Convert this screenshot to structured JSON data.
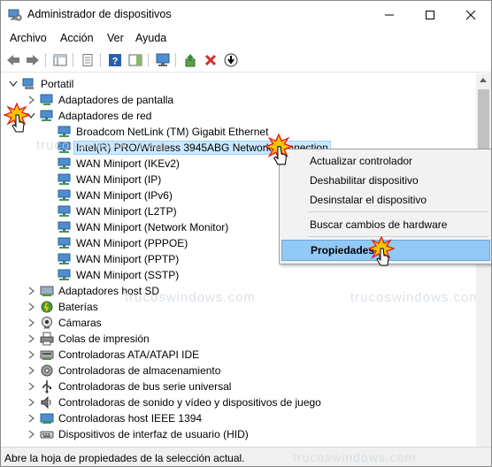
{
  "window": {
    "title": "Administrador de dispositivos"
  },
  "menu": [
    "Archivo",
    "Acción",
    "Ver",
    "Ayuda"
  ],
  "tree": {
    "root": "Portatil",
    "items": [
      "Adaptadores de pantalla",
      "Adaptadores de red",
      "Broadcom NetLink (TM) Gigabit Ethernet",
      "Intel(R) PRO/Wireless 3945ABG Network Connection",
      "WAN Miniport (IKEv2)",
      "WAN Miniport (IP)",
      "WAN Miniport (IPv6)",
      "WAN Miniport (L2TP)",
      "WAN Miniport (Network Monitor)",
      "WAN Miniport (PPPOE)",
      "WAN Miniport (PPTP)",
      "WAN Miniport (SSTP)",
      "Adaptadores host SD",
      "Baterías",
      "Cámaras",
      "Colas de impresión",
      "Controladoras ATA/ATAPI IDE",
      "Controladoras de almacenamiento",
      "Controladoras de bus serie universal",
      "Controladoras de sonido y vídeo y dispositivos de juego",
      "Controladoras host IEEE 1394",
      "Dispositivos de interfaz de usuario (HID)"
    ]
  },
  "context_menu": {
    "update_driver": "Actualizar controlador",
    "disable": "Deshabilitar dispositivo",
    "uninstall": "Desinstalar el dispositivo",
    "scan": "Buscar cambios de hardware",
    "properties": "Propiedades"
  },
  "status": "Abre la hoja de propiedades de la selección actual.",
  "watermark": "trucoswindows.com",
  "colors": {
    "selection": "#cce8ff",
    "menu_highlight": "#91c9f7",
    "uninstall_red": "#d32f2f"
  }
}
